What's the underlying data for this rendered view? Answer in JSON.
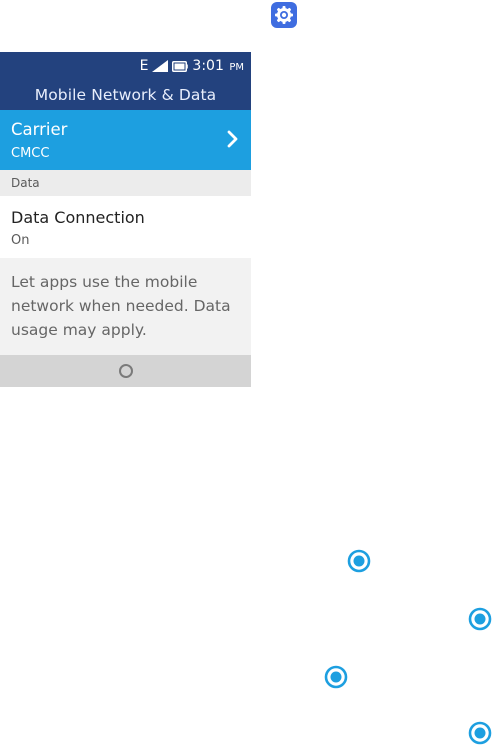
{
  "app_icon": {
    "icon": "settings-icon",
    "color": "#3f6de0"
  },
  "status_bar": {
    "network": "E",
    "time": "3:01",
    "ampm": "PM",
    "signal_icon": "signal-icon",
    "battery_icon": "battery-icon"
  },
  "header": {
    "title": "Mobile Network & Data",
    "background": "#23427e"
  },
  "carrier": {
    "title": "Carrier",
    "value": "CMCC",
    "background": "#1d9fe0",
    "chevron_icon": "chevron-right-icon"
  },
  "section": {
    "label": "Data"
  },
  "data_connection": {
    "title": "Data Connection",
    "value": "On"
  },
  "description": {
    "text": "Let apps use the mobile network when needed. Data usage may apply."
  },
  "softkey": {
    "center_icon": "circle-icon"
  },
  "markers": {
    "icon": "target-marker-icon",
    "color": "#1d9fe0",
    "count": 4
  }
}
